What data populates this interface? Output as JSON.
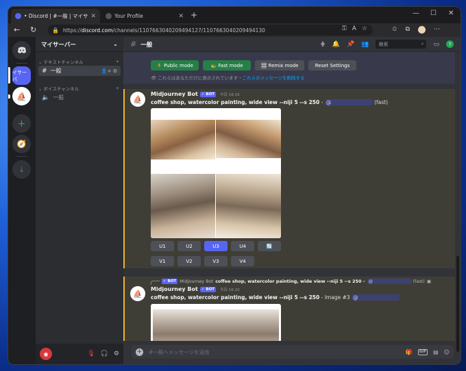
{
  "browser": {
    "tabs": [
      {
        "label": "• Discord | #一般 | マイサーバー",
        "close": "✕"
      },
      {
        "label": "Your Profile",
        "close": "✕"
      }
    ],
    "new_tab": "+",
    "url_prefix": "https://",
    "url_host": "discord.com",
    "url_path": "/channels/1107663040209494127/1107663040209494130",
    "window_controls": [
      "—",
      "☐",
      "✕"
    ]
  },
  "server": {
    "name": "マイサーバー",
    "active_guild_label": "イサーバ",
    "text_category": "テキストチャンネル",
    "voice_category": "ボイスチャンネル",
    "text_channels": [
      "一般"
    ],
    "voice_channels": [
      "一般"
    ]
  },
  "header": {
    "channel_name": "一般",
    "search_placeholder": "検索",
    "help": "?"
  },
  "settings_buttons": [
    {
      "label": "Public mode",
      "icon": "🧍",
      "style": "green"
    },
    {
      "label": "Fast mode",
      "icon": "🐢",
      "style": "green"
    },
    {
      "label": "Remix mode",
      "icon": "🎛",
      "style": "gray"
    },
    {
      "label": "Reset Settings",
      "icon": "",
      "style": "gray"
    }
  ],
  "ephemeral_note": "これらはあなただけに表示されています・",
  "ephemeral_link": "これらのメッセージを削除する",
  "messages": [
    {
      "author": "Midjourney Bot",
      "badge": "✓ BOT",
      "time": "今日 16:16",
      "prompt": "coffee shop, watercolor painting, wide view --niji 5 --s 250",
      "sep": " - ",
      "mention": "@",
      "suffix": " (fast)",
      "upscale_buttons": [
        "U1",
        "U2",
        "U3",
        "U4"
      ],
      "variation_buttons": [
        "V1",
        "V2",
        "V3",
        "V4"
      ],
      "refresh_icon": "🔄"
    },
    {
      "reply_badge": "✓ BOT",
      "reply_author": "Midjourney Bot",
      "reply_text": "coffee shop, watercolor painting, wide view --niji 5 --s 250 -",
      "reply_mention": "@",
      "reply_suffix": " (fast)",
      "author": "Midjourney Bot",
      "badge": "✓ BOT",
      "time": "今日 16:20",
      "prompt": "coffee shop, watercolor painting, wide view --niji 5 --s 250",
      "sep": " - Image #3 ",
      "mention": "@"
    }
  ],
  "composer": {
    "placeholder": "#一般へメッセージを送信",
    "gif": "GIF"
  }
}
